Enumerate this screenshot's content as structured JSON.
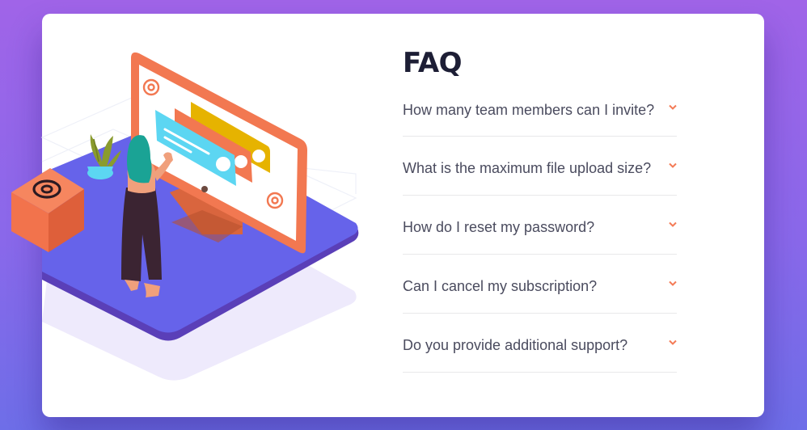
{
  "faq": {
    "title": "FAQ",
    "items": [
      {
        "question": "How many team members can I invite?",
        "expanded": false
      },
      {
        "question": "What is the maximum file upload size?",
        "expanded": false
      },
      {
        "question": "How do I reset my password?",
        "expanded": false
      },
      {
        "question": "Can I cancel my subscription?",
        "expanded": false
      },
      {
        "question": "Do you provide additional support?",
        "expanded": false
      }
    ]
  },
  "icons": {
    "toggle": "chevron-down-icon",
    "box_symbol": "at-sign-icon"
  },
  "colors": {
    "background_top": "#a064e8",
    "background_bottom": "#6e6ee8",
    "card": "#ffffff",
    "title": "#1d1e35",
    "question_text": "#4a4b5e",
    "accent_chevron": "#f47b56",
    "divider": "#e8e8ea",
    "platform": "#6e5ee8"
  }
}
